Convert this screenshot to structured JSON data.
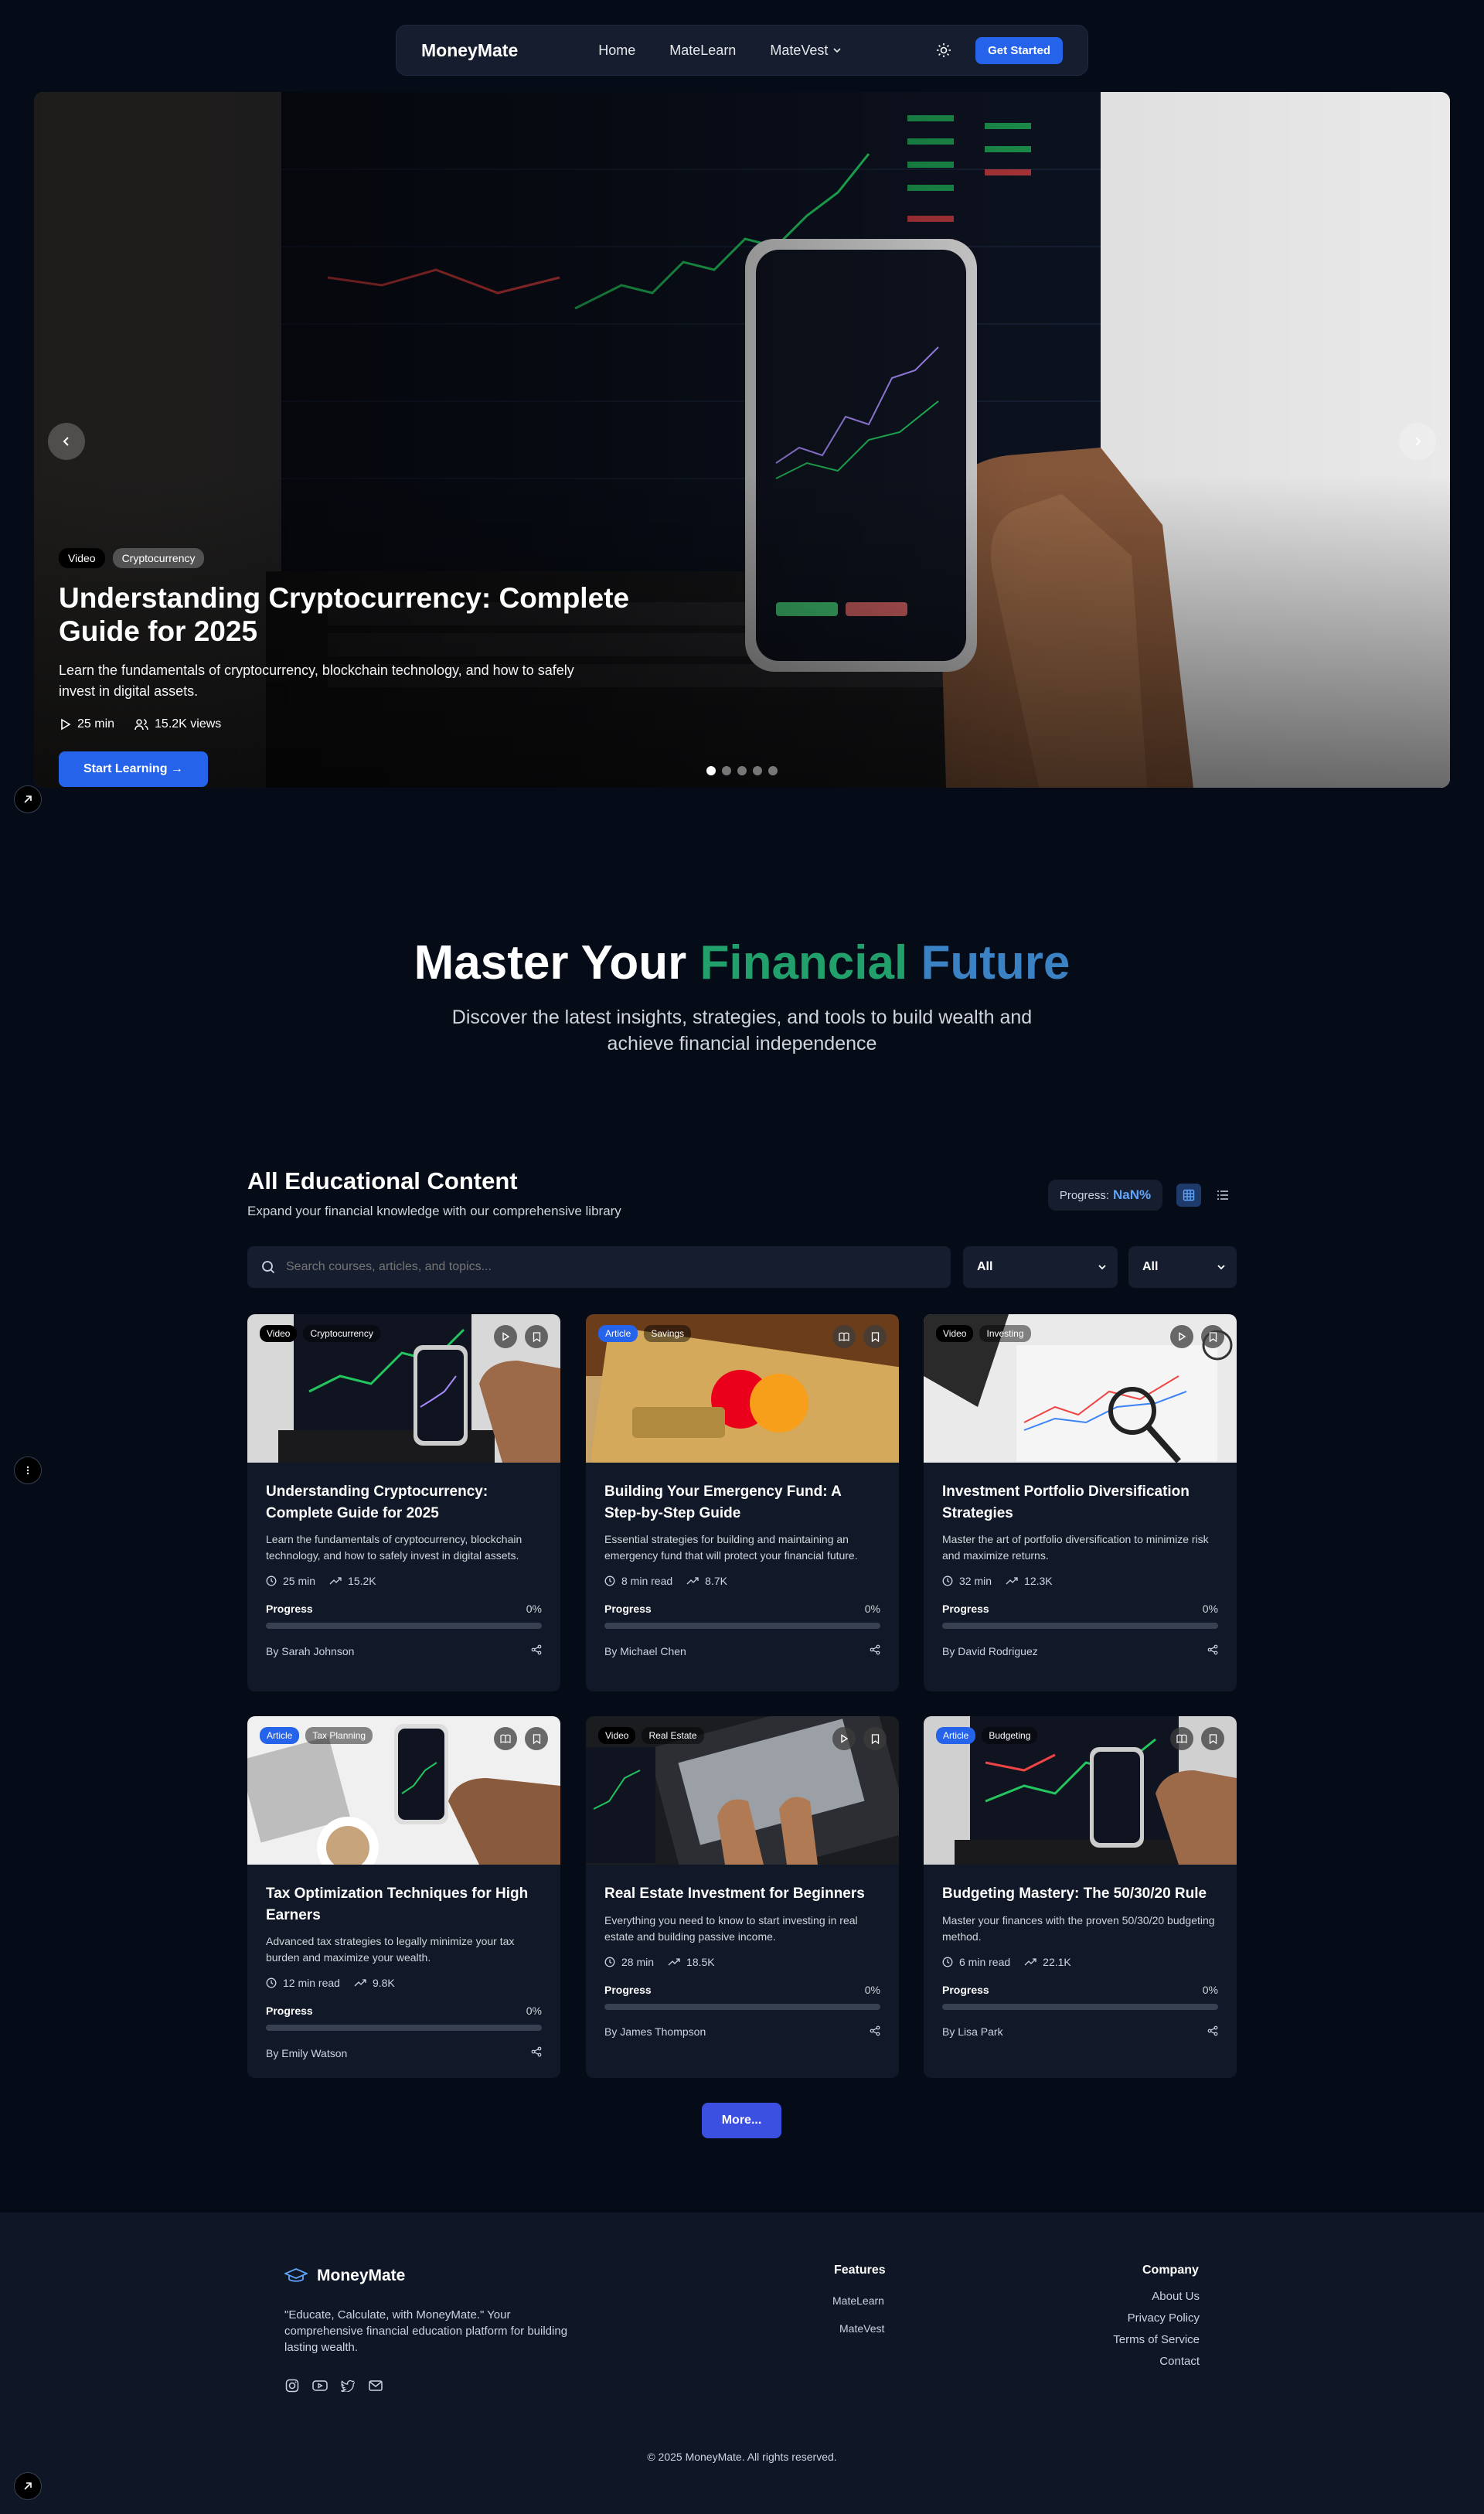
{
  "nav": {
    "brand": "MoneyMate",
    "links": [
      "Home",
      "MateLearn",
      "MateVest"
    ],
    "cta": "Get Started",
    "icons": {
      "theme": "sun-icon",
      "dropdown": "chevron-down-icon"
    }
  },
  "hero": {
    "badges": [
      "Video",
      "Cryptocurrency"
    ],
    "title": "Understanding Cryptocurrency: Complete Guide for 2025",
    "description": "Learn the fundamentals of cryptocurrency, blockchain technology, and how to safely invest in digital assets.",
    "duration": "25 min",
    "views": "15.2K views",
    "button": "Start Learning →",
    "slide_count": 5,
    "active_slide": 1
  },
  "headline": {
    "part1": "Master Your ",
    "part2": "Financial ",
    "part3": "Future",
    "subtitle": "Discover the latest insights, strategies, and tools to build wealth and achieve financial independence"
  },
  "library": {
    "title": "All Educational Content",
    "subtitle": "Expand your financial knowledge with our comprehensive library",
    "progress_label": "Progress:",
    "progress_value": "NaN%",
    "search_placeholder": "Search courses, articles, and topics...",
    "filter1": "All",
    "filter2": "All",
    "more": "More..."
  },
  "cards": [
    {
      "type": "Video",
      "category": "Cryptocurrency",
      "title": "Understanding Cryptocurrency: Complete Guide for 2025",
      "description": "Learn the fundamentals of cryptocurrency, blockchain technology, and how to safely invest in digital assets.",
      "time": "25 min",
      "stat": "15.2K",
      "progress_label": "Progress",
      "progress": "0%",
      "author": "By Sarah Johnson"
    },
    {
      "type": "Article",
      "category": "Savings",
      "title": "Building Your Emergency Fund: A Step-by-Step Guide",
      "description": "Essential strategies for building and maintaining an emergency fund that will protect your financial future.",
      "time": "8 min read",
      "stat": "8.7K",
      "progress_label": "Progress",
      "progress": "0%",
      "author": "By Michael Chen"
    },
    {
      "type": "Video",
      "category": "Investing",
      "title": "Investment Portfolio Diversification Strategies",
      "description": "Master the art of portfolio diversification to minimize risk and maximize returns.",
      "time": "32 min",
      "stat": "12.3K",
      "progress_label": "Progress",
      "progress": "0%",
      "author": "By David Rodriguez"
    },
    {
      "type": "Article",
      "category": "Tax Planning",
      "title": "Tax Optimization Techniques for High Earners",
      "description": "Advanced tax strategies to legally minimize your tax burden and maximize your wealth.",
      "time": "12 min read",
      "stat": "9.8K",
      "progress_label": "Progress",
      "progress": "0%",
      "author": "By Emily Watson"
    },
    {
      "type": "Video",
      "category": "Real Estate",
      "title": "Real Estate Investment for Beginners",
      "description": "Everything you need to know to start investing in real estate and building passive income.",
      "time": "28 min",
      "stat": "18.5K",
      "progress_label": "Progress",
      "progress": "0%",
      "author": "By James Thompson"
    },
    {
      "type": "Article",
      "category": "Budgeting",
      "title": "Budgeting Mastery: The 50/30/20 Rule",
      "description": "Master your finances with the proven 50/30/20 budgeting method.",
      "time": "6 min read",
      "stat": "22.1K",
      "progress_label": "Progress",
      "progress": "0%",
      "author": "By Lisa Park"
    }
  ],
  "footer": {
    "brand": "MoneyMate",
    "description": "\"Educate, Calculate, with MoneyMate.\" Your comprehensive financial education platform for building lasting wealth.",
    "features_title": "Features",
    "features": [
      "MateLearn",
      "MateVest"
    ],
    "company_title": "Company",
    "company": [
      "About Us",
      "Privacy Policy",
      "Terms of Service",
      "Contact"
    ],
    "copyright": "© 2025 MoneyMate. All rights reserved.",
    "social_icons": [
      "instagram-icon",
      "youtube-icon",
      "twitter-icon",
      "mail-icon"
    ]
  },
  "colors": {
    "accent": "#2563eb",
    "green": "#22a06b",
    "blue": "#3b82c4",
    "background": "#060b18",
    "card": "#111827"
  }
}
